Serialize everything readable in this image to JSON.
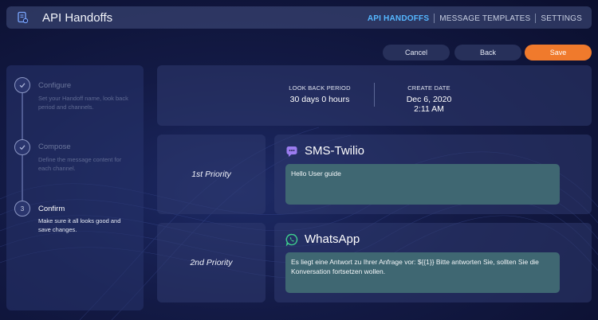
{
  "header": {
    "title": "API Handoffs",
    "nav": [
      {
        "label": "API HANDOFFS",
        "active": true
      },
      {
        "label": "MESSAGE TEMPLATES",
        "active": false
      },
      {
        "label": "SETTINGS",
        "active": false
      }
    ]
  },
  "actions": {
    "cancel_label": "Cancel",
    "back_label": "Back",
    "save_label": "Save"
  },
  "steps": [
    {
      "title": "Configure",
      "description": "Set your Handoff name, look back period and channels.",
      "state": "done",
      "icon": "check-icon"
    },
    {
      "title": "Compose",
      "description": "Define the message content for each channel.",
      "state": "done",
      "icon": "check-icon"
    },
    {
      "number": "3",
      "title": "Confirm",
      "description": "Make sure it all looks good and save changes.",
      "state": "current"
    }
  ],
  "summary": {
    "look_back_label": "LOOK BACK PERIOD",
    "look_back_value": "30 days 0 hours",
    "create_date_label": "CREATE DATE",
    "create_date_value": "Dec 6, 2020",
    "create_time_value": "2:11 AM"
  },
  "priorities": [
    {
      "label": "1st Priority",
      "channel": "SMS-Twilio",
      "channel_icon": "sms-chat-icon",
      "message": "Hello User guide"
    },
    {
      "label": "2nd Priority",
      "channel": "WhatsApp",
      "channel_icon": "whatsapp-icon",
      "message": "Es liegt eine Antwort zu Ihrer Anfrage vor: ${{1}} Bitte antworten Sie, sollten Sie die Konversation fortsetzen wollen."
    }
  ],
  "colors": {
    "accent": "#55b7ff",
    "save_button": "#f07a2c",
    "message_box": "#3f6772",
    "sms_icon": "#9b7cf0",
    "whatsapp_icon": "#3ecf8e"
  }
}
